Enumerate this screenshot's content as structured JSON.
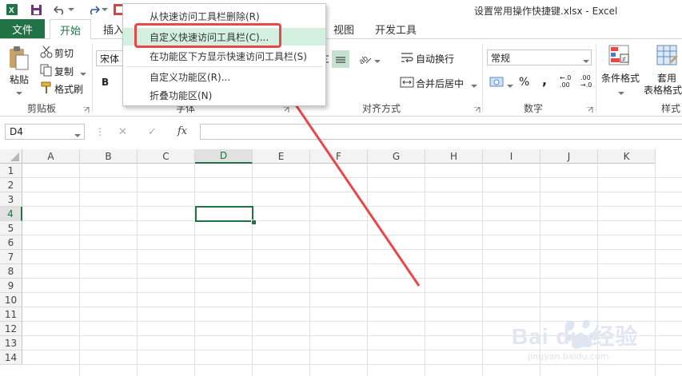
{
  "window": {
    "title": "设置常用操作快捷键.xlsx - Excel"
  },
  "tabs": [
    {
      "label": "文件"
    },
    {
      "label": "开始"
    },
    {
      "label": "插入"
    },
    {
      "label": "视图"
    },
    {
      "label": "开发工具"
    }
  ],
  "ribbon": {
    "clipboard": {
      "paste": "粘贴",
      "cut": "剪切",
      "copy": "复制",
      "format_painter": "格式刷",
      "group_label": "剪贴板"
    },
    "font": {
      "font_name": "宋体",
      "bold": "B",
      "group_label_partial": "字体"
    },
    "alignment": {
      "wrap_text": "自动换行",
      "merge_center": "合并后居中",
      "group_label": "对齐方式"
    },
    "number": {
      "format": "常规",
      "percent": "%",
      "comma": ",",
      "inc_decimal": "←.0 .00",
      "dec_decimal": ".00 →.0",
      "group_label": "数字"
    },
    "styles": {
      "conditional": "条件格式",
      "table_line1": "套用",
      "table_line2": "表格格式",
      "group_label_partial": "样式"
    }
  },
  "formula_bar": {
    "name_box": "D4",
    "fx": "fx",
    "cancel": "✕",
    "enter": "✓"
  },
  "grid": {
    "columns": [
      "A",
      "B",
      "C",
      "D",
      "E",
      "F",
      "G",
      "H",
      "I",
      "J",
      "K"
    ],
    "rows": [
      "1",
      "2",
      "3",
      "4",
      "5",
      "6",
      "7",
      "8",
      "9",
      "10",
      "11",
      "12",
      "13",
      "14"
    ],
    "selected_cell": "D4"
  },
  "context_menu": {
    "items": [
      {
        "label": "从快速访问工具栏删除(R)"
      },
      {
        "label": "自定义快速访问工具栏(C)..."
      },
      {
        "label": "在功能区下方显示快速访问工具栏(S)"
      },
      {
        "label": "自定义功能区(R)..."
      },
      {
        "label": "折叠功能区(N)"
      }
    ],
    "highlighted_index": 1
  },
  "watermark": {
    "brand": "Bai du 经验",
    "url": "jingyan.baidu.com"
  },
  "colors": {
    "excel_green": "#217346",
    "annotation_red": "#e8484a",
    "menu_highlight": "#d3f0e0"
  }
}
